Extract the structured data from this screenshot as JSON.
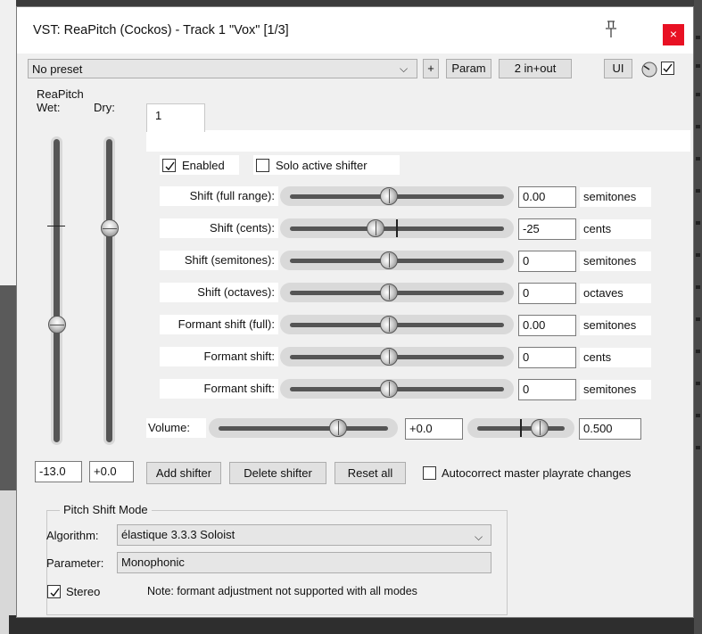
{
  "window": {
    "title": "VST: ReaPitch (Cockos) - Track 1 \"Vox\" [1/3]",
    "close_label": "×"
  },
  "toolbar": {
    "preset": "No preset",
    "add_label": "+",
    "param_label": "Param",
    "io_label": "2 in+out",
    "ui_label": "UI",
    "bypass_checked": true
  },
  "plugin": {
    "name": "ReaPitch",
    "wet_label": "Wet:",
    "dry_label": "Dry:",
    "wet_value": "-13.0",
    "dry_value": "+0.0",
    "wet_level": 0.38,
    "dry_level": 0.72
  },
  "tab": {
    "label": "1"
  },
  "shifter": {
    "enabled_label": "Enabled",
    "enabled_checked": true,
    "solo_label": "Solo active shifter",
    "solo_checked": false,
    "rows": [
      {
        "label": "Shift (full range):",
        "value": "0.00",
        "unit": "semitones"
      },
      {
        "label": "Shift (cents):",
        "value": "-25",
        "unit": "cents"
      },
      {
        "label": "Shift (semitones):",
        "value": "0",
        "unit": "semitones"
      },
      {
        "label": "Shift (octaves):",
        "value": "0",
        "unit": "octaves"
      },
      {
        "label": "Formant shift (full):",
        "value": "0.00",
        "unit": "semitones"
      },
      {
        "label": "Formant shift:",
        "value": "0",
        "unit": "cents"
      },
      {
        "label": "Formant shift:",
        "value": "0",
        "unit": "semitones"
      }
    ],
    "volume_label": "Volume:",
    "volume_value": "+0.0",
    "pan_value": "0.500"
  },
  "actions": {
    "add_shifter": "Add shifter",
    "delete_shifter": "Delete shifter",
    "reset_all": "Reset all",
    "autocorrect_label": "Autocorrect master playrate changes",
    "autocorrect_checked": false
  },
  "mode": {
    "group_title": "Pitch Shift Mode",
    "algorithm_label": "Algorithm:",
    "algorithm_value": "élastique 3.3.3 Soloist",
    "parameter_label": "Parameter:",
    "parameter_value": "Monophonic",
    "stereo_label": "Stereo",
    "stereo_checked": true,
    "note": "Note: formant adjustment not supported with all modes"
  }
}
